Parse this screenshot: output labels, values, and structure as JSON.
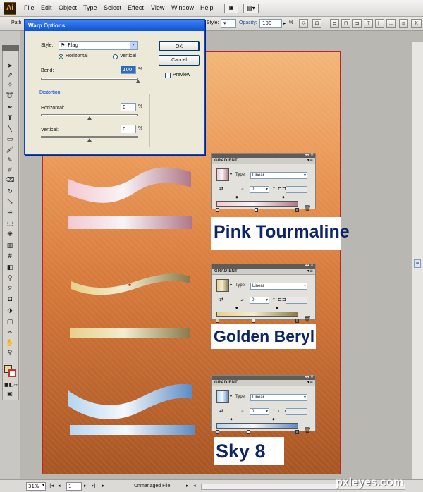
{
  "app": {
    "logo": "Ai"
  },
  "menu": [
    "File",
    "Edit",
    "Object",
    "Type",
    "Select",
    "Effect",
    "View",
    "Window",
    "Help"
  ],
  "control_bar": {
    "left_label": "Path",
    "style_label": "Style:",
    "opacity_label": "Opacity:",
    "opacity_value": "100",
    "opacity_unit": "%"
  },
  "warp_dialog": {
    "title": "Warp Options",
    "style_label": "Style:",
    "style_value": "Flag",
    "horizontal_label": "Horizontal",
    "vertical_label": "Vertical",
    "orientation": "Horizontal",
    "bend_label": "Bend:",
    "bend_value": "100",
    "distortion_label": "Distortion",
    "dist_horizontal_label": "Horizontal:",
    "dist_horizontal_value": "0",
    "dist_vertical_label": "Vertical:",
    "dist_vertical_value": "0",
    "percent": "%",
    "ok_label": "OK",
    "cancel_label": "Cancel",
    "preview_label": "Preview",
    "preview_checked": false,
    "bend_level": 1.0,
    "horizontal_level": 0.5,
    "vertical_level": 0.5
  },
  "gradient_panels": [
    {
      "tab": "GRADIENT",
      "type_label": "Type:",
      "type_value": "Linear",
      "angle_value": "0",
      "name": "Pink Tourmaline",
      "start_color": "#f6c8d2",
      "mid_color": "#f7f4f7",
      "end_color": "#b07888"
    },
    {
      "tab": "GRADIENT",
      "type_label": "Type:",
      "type_value": "Linear",
      "angle_value": "0",
      "name": "Golden Beryl",
      "start_color": "#e8d08a",
      "mid_color": "#f3ecd0",
      "end_color": "#8a7a4a"
    },
    {
      "tab": "GRADIENT",
      "type_label": "Type:",
      "type_value": "Linear",
      "angle_value": "0",
      "name": "Sky 8",
      "start_color": "#b5d6f2",
      "mid_color": "#f4f8fc",
      "end_color": "#5b8bc4"
    }
  ],
  "status_bar": {
    "zoom": "31%",
    "page": "1",
    "file_status": "Unmanaged File"
  },
  "watermark": "pxleyes.com",
  "colors": {
    "artboard_border": "#c02525",
    "dialog_title": "#0a54d9"
  }
}
